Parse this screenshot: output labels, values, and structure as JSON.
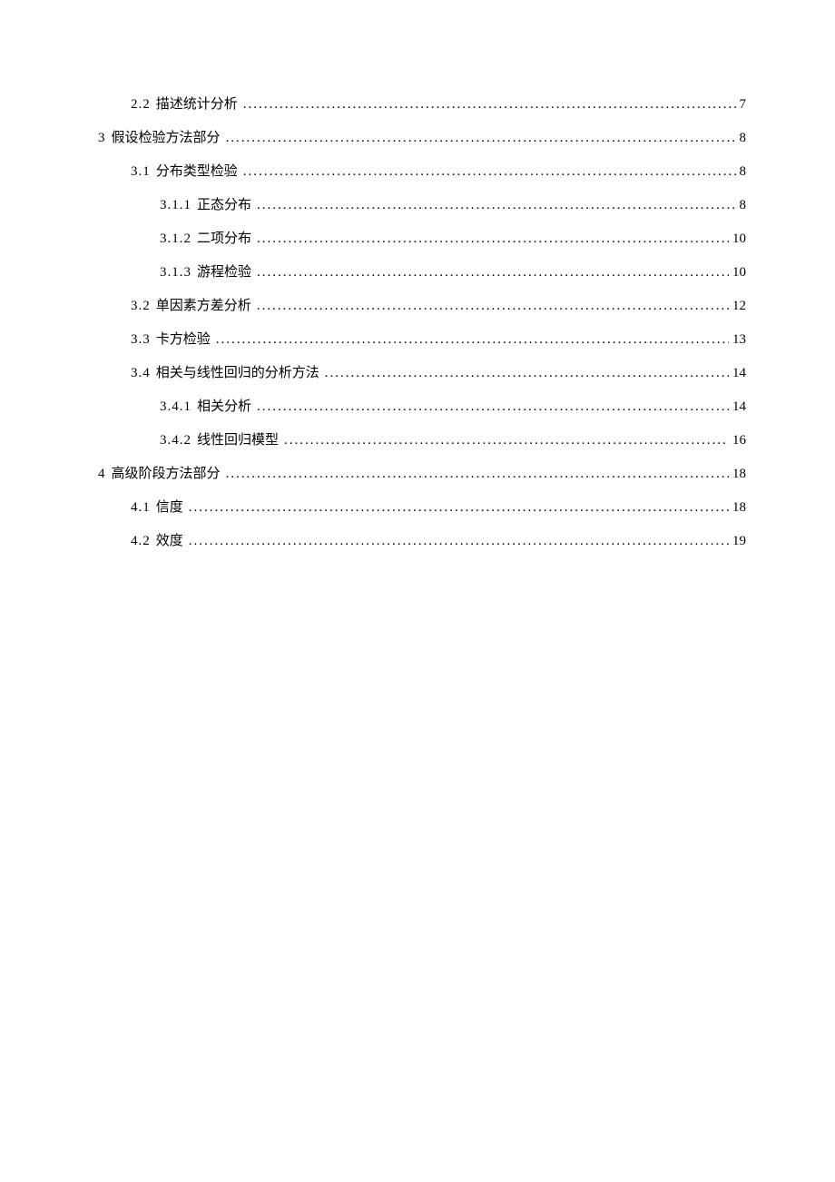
{
  "toc": [
    {
      "level": 2,
      "num": "2.2",
      "title": "描述统计分析",
      "page": "7"
    },
    {
      "level": 1,
      "num": "3",
      "title": "假设检验方法部分",
      "page": "8"
    },
    {
      "level": 2,
      "num": "3.1",
      "title": "分布类型检验",
      "page": "8"
    },
    {
      "level": 3,
      "num": "3.1.1",
      "title": "正态分布",
      "page": "8"
    },
    {
      "level": 3,
      "num": "3.1.2",
      "title": "二项分布",
      "page": "10"
    },
    {
      "level": 3,
      "num": "3.1.3",
      "title": "游程检验",
      "page": "10"
    },
    {
      "level": 2,
      "num": "3.2",
      "title": "单因素方差分析",
      "page": "12"
    },
    {
      "level": 2,
      "num": "3.3",
      "title": "卡方检验",
      "page": "13"
    },
    {
      "level": 2,
      "num": "3.4",
      "title": "相关与线性回归的分析方法",
      "page": "14"
    },
    {
      "level": 3,
      "num": "3.4.1",
      "title": "相关分析",
      "page": "14"
    },
    {
      "level": 3,
      "num": "3.4.2",
      "title": "线性回归模型",
      "page": "16"
    },
    {
      "level": 1,
      "num": "4",
      "title": "高级阶段方法部分",
      "page": "18"
    },
    {
      "level": 2,
      "num": "4.1",
      "title": "信度",
      "page": "18"
    },
    {
      "level": 2,
      "num": "4.2",
      "title": "效度",
      "page": "19"
    }
  ]
}
